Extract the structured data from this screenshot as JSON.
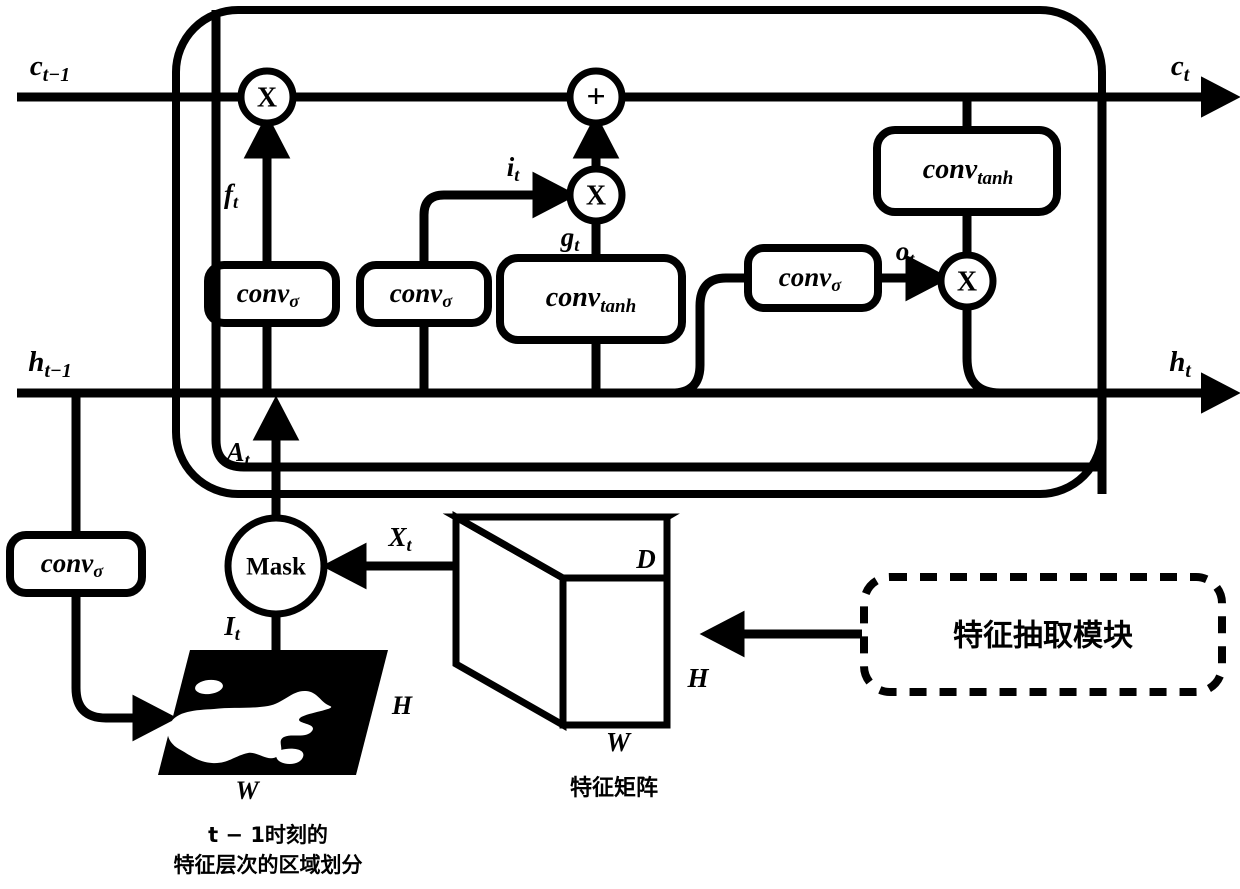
{
  "diagram": {
    "title": "ConvLSTM cell with region mask attention",
    "colors": {
      "stroke": "#000000",
      "background": "#ffffff",
      "mask_region_fill": "#000000"
    },
    "signals": {
      "c_prev": "c",
      "c_prev_sub": "t−1",
      "c_out": "c",
      "c_out_sub": "t",
      "h_prev": "h",
      "h_prev_sub": "t−1",
      "h_out": "h",
      "h_out_sub": "t",
      "forget": "f",
      "forget_sub": "t",
      "input": "i",
      "input_sub": "t",
      "candidate": "g",
      "candidate_sub": "t",
      "output": "o",
      "output_sub": "t",
      "attention": "A",
      "attention_sub": "t",
      "feature": "X",
      "feature_sub": "t",
      "region": "I",
      "region_sub": "t"
    },
    "gates": [
      {
        "id": "conv-sigma-forget",
        "name": "conv",
        "subscript": "σ"
      },
      {
        "id": "conv-sigma-input",
        "name": "conv",
        "subscript": "σ"
      },
      {
        "id": "conv-tanh-candidate",
        "name": "conv",
        "subscript": "tanh"
      },
      {
        "id": "conv-sigma-output",
        "name": "conv",
        "subscript": "σ"
      },
      {
        "id": "conv-tanh-cell",
        "name": "conv",
        "subscript": "tanh"
      },
      {
        "id": "conv-sigma-mask",
        "name": "conv",
        "subscript": "σ"
      }
    ],
    "operators": {
      "multiply": "X",
      "add": "+",
      "mask": "Mask"
    },
    "tensor": {
      "depth_label": "D",
      "height_label": "H",
      "width_label": "W",
      "caption": "特征矩阵"
    },
    "region_map": {
      "height_label": "H",
      "width_label": "W",
      "caption_line1": "t − 1时刻的",
      "caption_line2": "特征层次的区域划分"
    },
    "module": {
      "label": "特征抽取模块"
    }
  }
}
